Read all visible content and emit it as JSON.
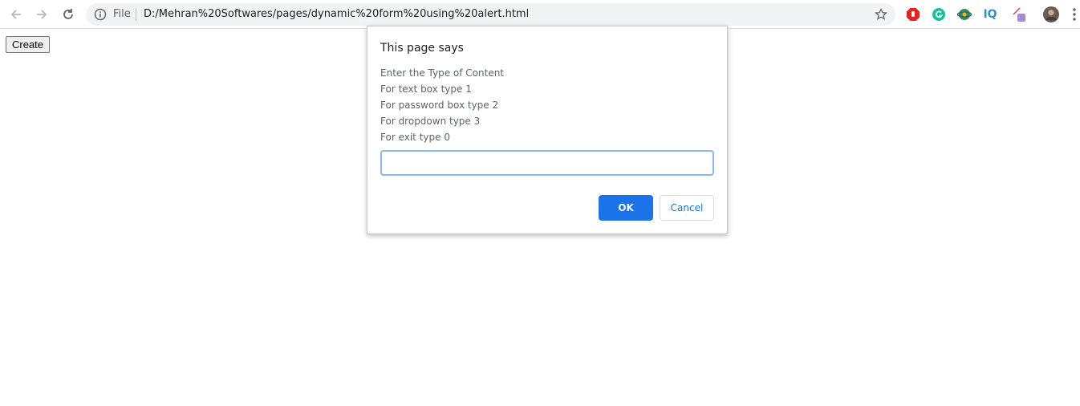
{
  "browser": {
    "omnibox": {
      "scheme_label": "File",
      "url": "D:/Mehran%20Softwares/pages/dynamic%20form%20using%20alert.html"
    },
    "icons": [
      "back-arrow-icon",
      "forward-arrow-icon",
      "reload-icon",
      "info-icon",
      "bookmark-star-icon",
      "adblock-icon",
      "grammarly-icon",
      "idm-icon",
      "iq-icon",
      "extension-puzzle-icon",
      "profile-avatar-icon",
      "kebab-menu-icon"
    ],
    "extensions": {
      "iq_label": "IQ"
    }
  },
  "page": {
    "create_button": "Create"
  },
  "dialog": {
    "title": "This page says",
    "message_lines": [
      "Enter the Type of Content",
      "For text box type 1",
      "For password box type 2",
      "For dropdown type 3",
      "For exit type 0"
    ],
    "input_value": "",
    "ok_label": "OK",
    "cancel_label": "Cancel"
  },
  "colors": {
    "accent": "#1a73e8",
    "focus": "#8ab4f8",
    "omnibox_bg": "#f1f3f4"
  }
}
